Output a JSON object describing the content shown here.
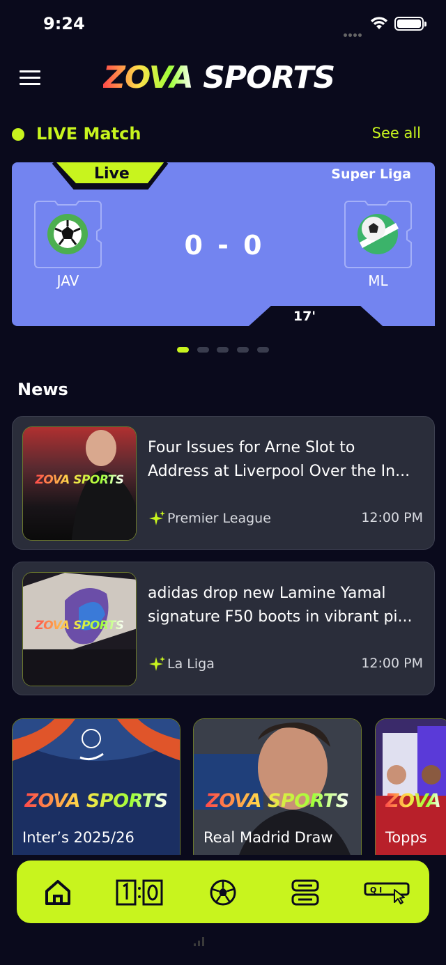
{
  "status_bar": {
    "time": "9:24"
  },
  "header": {
    "logo_part1": "ZOVA",
    "logo_part2": "SPORTS"
  },
  "live_section": {
    "title": "LIVE Match",
    "see_all": "See all"
  },
  "live_match": {
    "status": "Live",
    "league": "Super Liga",
    "home_team": "JAV",
    "away_team": "ML",
    "score": "0 - 0",
    "minute": "17'"
  },
  "carousel": {
    "count": 5,
    "active_index": 0
  },
  "news_section": {
    "title": "News"
  },
  "news": [
    {
      "headline_line1": "Four Issues for Arne Slot to",
      "headline_line2": "Address at Liverpool Over the In...",
      "league": "Premier League",
      "time": "12:00 PM",
      "thumb_logo": "ZOVA SPORTS"
    },
    {
      "headline_line1": "adidas drop new Lamine Yamal",
      "headline_line2": "signature F50 boots in vibrant pi...",
      "league": "La Liga",
      "time": "12:00 PM",
      "thumb_logo": "ZOVA SPORTS"
    }
  ],
  "stories": [
    {
      "caption": "Inter’s 2025/26",
      "logo": "ZOVA SPORTS"
    },
    {
      "caption": "Real Madrid Draw",
      "logo": "ZOVA SPORTS"
    },
    {
      "caption": "Topps",
      "logo": "ZOVA"
    }
  ],
  "tabbar": {
    "active": "home",
    "tabs": [
      "home-icon",
      "scoreboard-icon",
      "football-icon",
      "fixtures-icon",
      "search-icon"
    ]
  },
  "colors": {
    "accent": "#c8f41e",
    "background": "#0a0a1c",
    "match_card": "#7384f0",
    "card": "#2a2d3a"
  }
}
